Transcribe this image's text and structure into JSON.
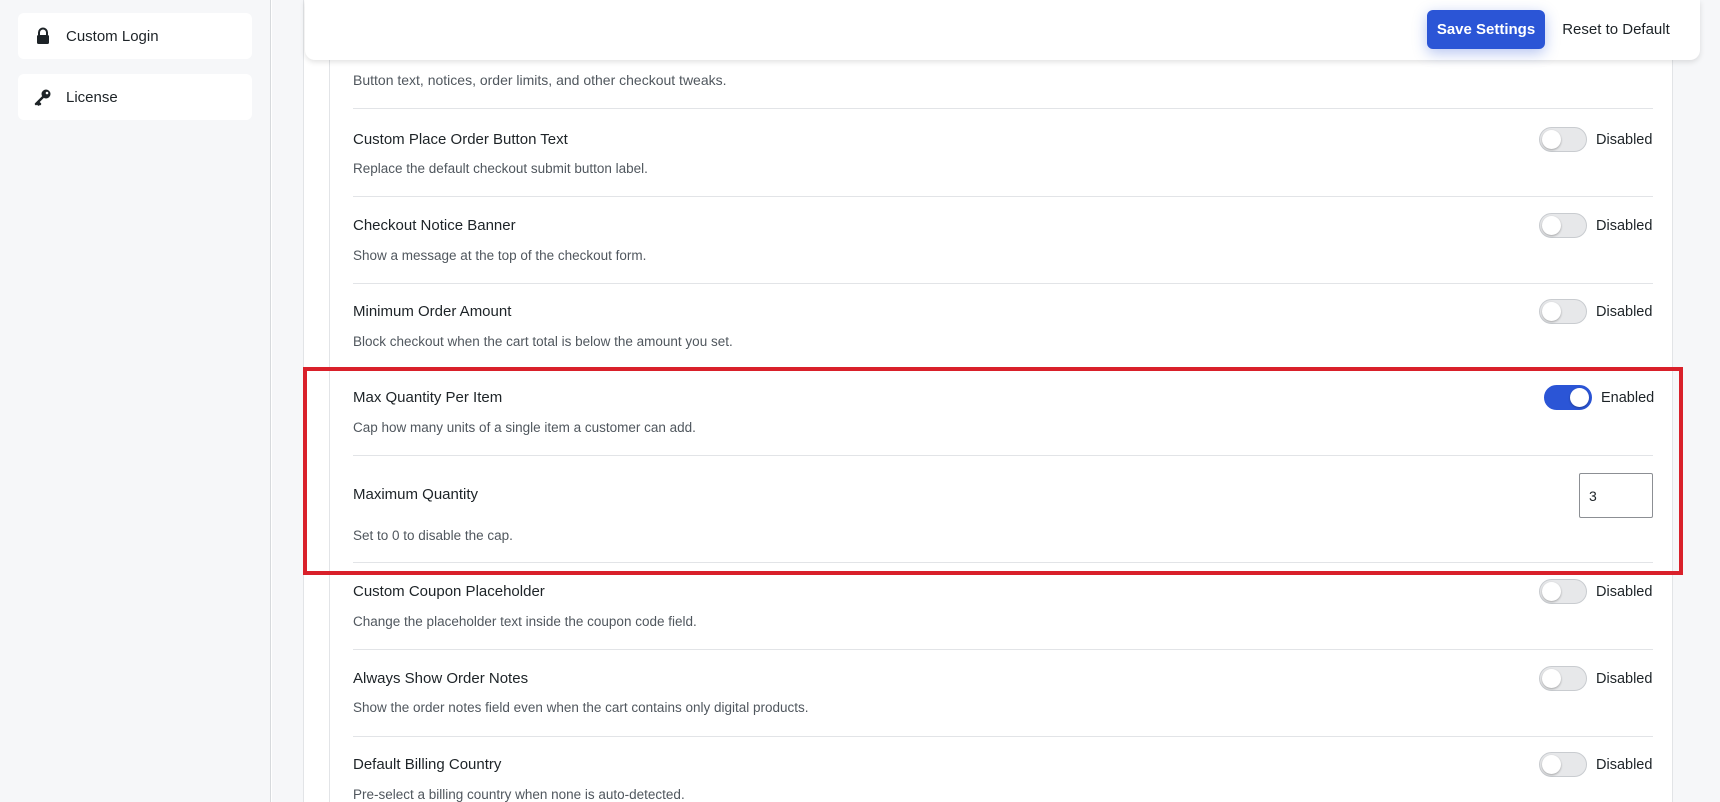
{
  "sidebar": {
    "items": [
      {
        "label": "Custom Login",
        "icon": "lock-icon"
      },
      {
        "label": "License",
        "icon": "key-icon"
      }
    ]
  },
  "toolbar": {
    "save_label": "Save Settings",
    "reset_label": "Reset to Default",
    "accent_color": "#2b55d6"
  },
  "section": {
    "description": "Button text, notices, order limits, and other checkout tweaks."
  },
  "settings": [
    {
      "title": "Custom Place Order Button Text",
      "desc": "Replace the default checkout submit button label.",
      "status": "Disabled"
    },
    {
      "title": "Checkout Notice Banner",
      "desc": "Show a message at the top of the checkout form.",
      "status": "Disabled"
    },
    {
      "title": "Minimum Order Amount",
      "desc": "Block checkout when the cart total is below the amount you set.",
      "status": "Disabled"
    },
    {
      "title": "Max Quantity Per Item",
      "desc": "Cap how many units of a single item a customer can add.",
      "status": "Enabled"
    },
    {
      "title": "Custom Coupon Placeholder",
      "desc": "Change the placeholder text inside the coupon code field.",
      "status": "Disabled"
    },
    {
      "title": "Always Show Order Notes",
      "desc": "Show the order notes field even when the cart contains only digital products.",
      "status": "Disabled"
    },
    {
      "title": "Default Billing Country",
      "desc": "Pre-select a billing country when none is auto-detected.",
      "status": "Disabled"
    }
  ],
  "max_quantity": {
    "title": "Maximum Quantity",
    "desc": "Set to 0 to disable the cap.",
    "value": "3"
  },
  "highlight_color": "#d9202a"
}
